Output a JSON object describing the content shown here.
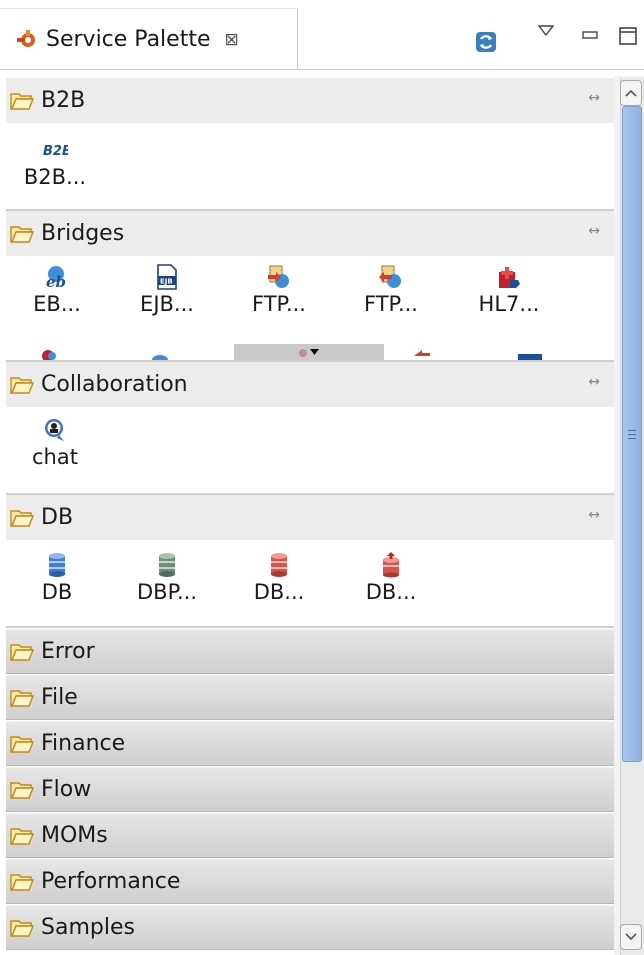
{
  "tab": {
    "title": "Service Palette",
    "close": "⊠",
    "icon": "palette-icon"
  },
  "toolbar": {
    "refresh_icon": "refresh-icon",
    "menu_icon": "view-menu-icon",
    "minimize_icon": "minimize-icon",
    "maximize_icon": "maximize-icon"
  },
  "drawers": {
    "b2b": {
      "label": "B2B",
      "pin": "↔",
      "items": [
        {
          "label": "B2B...",
          "icon": "b2b-icon"
        }
      ]
    },
    "bridges": {
      "label": "Bridges",
      "pin": "↔",
      "items": [
        {
          "label": "EB...",
          "icon": "eb-icon"
        },
        {
          "label": "EJB...",
          "icon": "ejb-icon"
        },
        {
          "label": "FTP...",
          "icon": "ftp-icon"
        },
        {
          "label": "FTP...",
          "icon": "ftp-icon"
        },
        {
          "label": "HL7...",
          "icon": "hl7-icon"
        }
      ]
    },
    "collaboration": {
      "label": "Collaboration",
      "pin": "↔",
      "items": [
        {
          "label": "chat",
          "icon": "chat-icon"
        }
      ]
    },
    "db": {
      "label": "DB",
      "pin": "↔",
      "items": [
        {
          "label": "DB",
          "icon": "database-blue-icon"
        },
        {
          "label": "DBP...",
          "icon": "database-green-icon"
        },
        {
          "label": "DB...",
          "icon": "database-red-icon"
        },
        {
          "label": "DB...",
          "icon": "database-red-arrow-icon"
        }
      ]
    },
    "closed": [
      {
        "label": "Error"
      },
      {
        "label": "File"
      },
      {
        "label": "Finance"
      },
      {
        "label": "Flow"
      },
      {
        "label": "MOMs"
      },
      {
        "label": "Performance"
      },
      {
        "label": "Samples"
      }
    ]
  },
  "colors": {
    "accent": "#8fb2e2",
    "header_bg": "#ececec",
    "closed_drawer": "#d6d6d6"
  }
}
